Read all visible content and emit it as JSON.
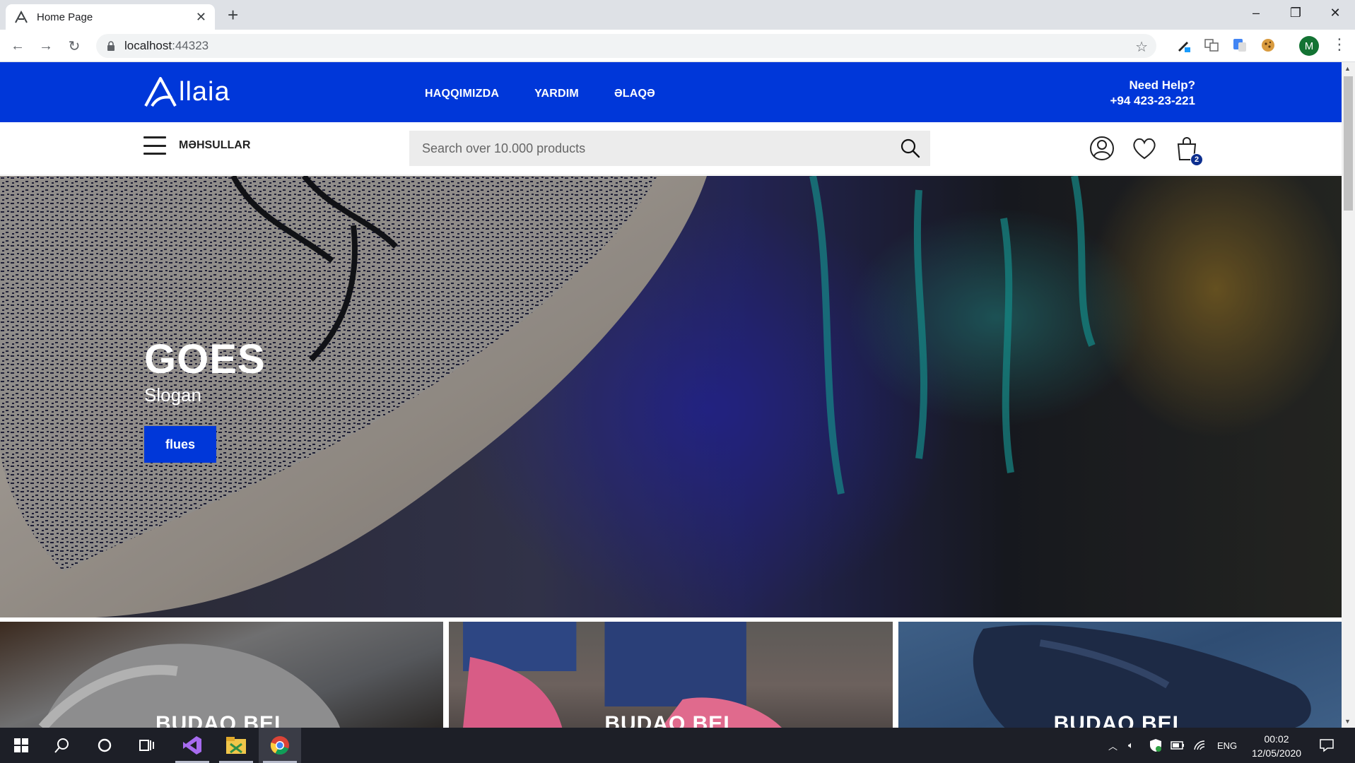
{
  "browser": {
    "tab_title": "Home Page",
    "url_host": "localhost",
    "url_port": ":44323",
    "profile_initial": "M"
  },
  "site": {
    "logo_text": "llaia",
    "menu": [
      "HAQQIMIZDA",
      "YARDIM",
      "ƏLAQƏ"
    ],
    "help_title": "Need Help?",
    "help_phone": "+94 423-23-221",
    "categories_label": "MƏHSULLAR",
    "search_placeholder": "Search over 10.000 products",
    "cart_count": "2",
    "accent": "#0037d9"
  },
  "hero": {
    "title": "GOES",
    "subtitle": "Slogan",
    "button": "flues",
    "slides_total": 3,
    "active_slide": 1
  },
  "category_tiles": [
    {
      "label": "BUDAQ BEL"
    },
    {
      "label": "BUDAQ BEL"
    },
    {
      "label": "BUDAQ BEL"
    }
  ],
  "taskbar": {
    "language": "ENG",
    "time": "00:02",
    "date": "12/05/2020"
  }
}
